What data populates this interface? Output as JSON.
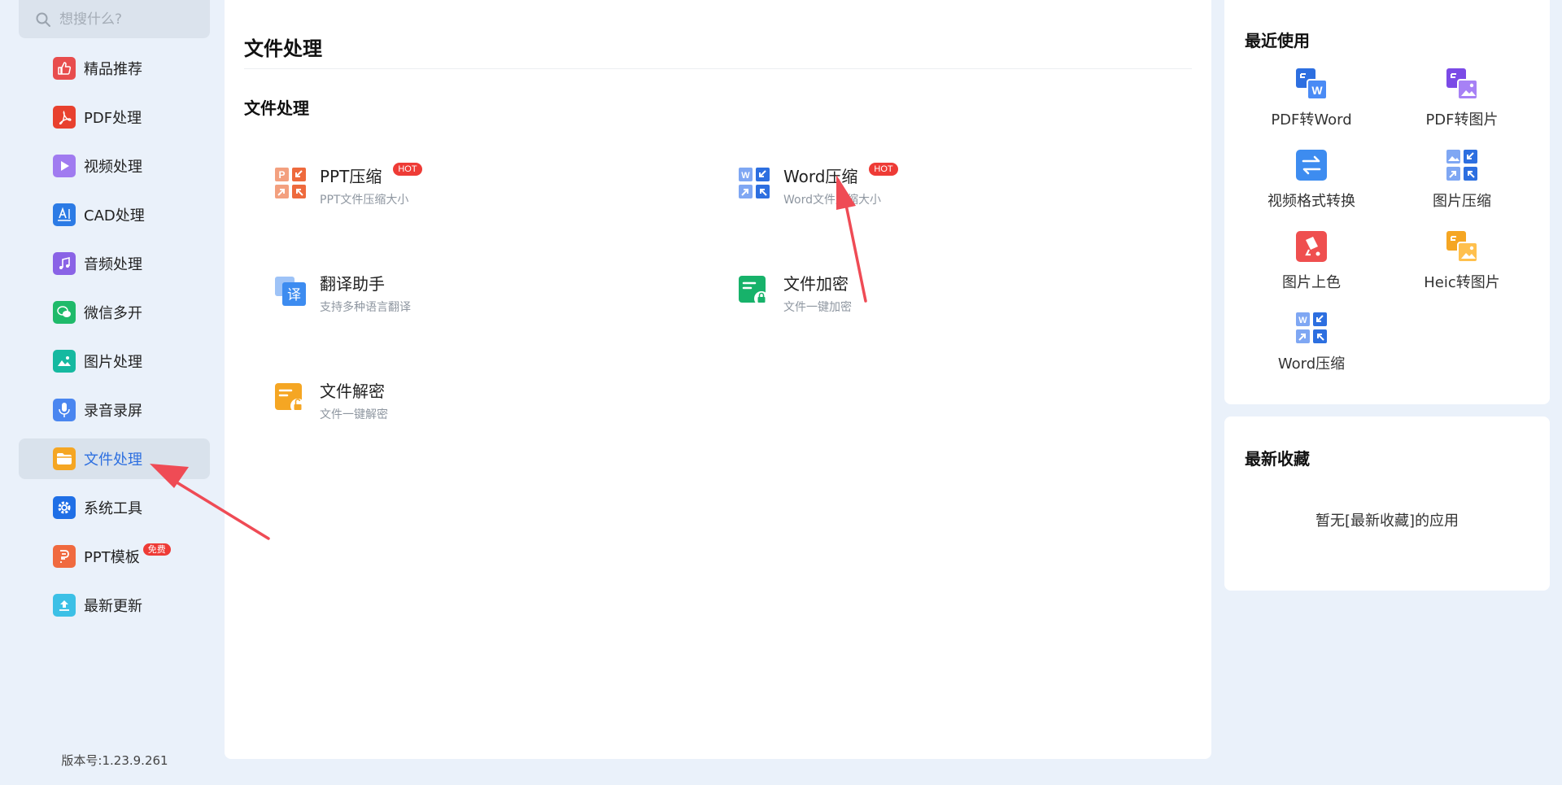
{
  "search": {
    "placeholder": "想搜什么?"
  },
  "sidebar": {
    "items": [
      {
        "label": "精品推荐",
        "icon": "thumbs-up-icon",
        "color": "#e84d4d"
      },
      {
        "label": "PDF处理",
        "icon": "pdf-icon",
        "color": "#e8412e"
      },
      {
        "label": "视频处理",
        "icon": "play-icon",
        "color": "#a07bf0"
      },
      {
        "label": "CAD处理",
        "icon": "cad-icon",
        "color": "#2c7be5"
      },
      {
        "label": "音频处理",
        "icon": "music-note-icon",
        "color": "#8a63e6"
      },
      {
        "label": "微信多开",
        "icon": "wechat-icon",
        "color": "#1fba6a"
      },
      {
        "label": "图片处理",
        "icon": "image-icon",
        "color": "#15b9a0"
      },
      {
        "label": "录音录屏",
        "icon": "microphone-icon",
        "color": "#4a86f0"
      },
      {
        "label": "文件处理",
        "icon": "folder-icon",
        "color": "#f5a623",
        "active": true
      },
      {
        "label": "系统工具",
        "icon": "gear-icon",
        "color": "#1f6fe6"
      },
      {
        "label": "PPT模板",
        "icon": "ppt-template-icon",
        "color": "#f06a3f",
        "badge": "免费"
      },
      {
        "label": "最新更新",
        "icon": "upload-icon",
        "color": "#3cc0e6"
      }
    ],
    "version": "版本号:1.23.9.261"
  },
  "main": {
    "title": "文件处理",
    "section_title": "文件处理",
    "tools": [
      {
        "name": "PPT压缩",
        "desc": "PPT文件压缩大小",
        "badge": "HOT",
        "icon": "ppt-compress-icon"
      },
      {
        "name": "Word压缩",
        "desc": "Word文件压缩大小",
        "badge": "HOT",
        "icon": "word-compress-icon"
      },
      {
        "name": "翻译助手",
        "desc": "支持多种语言翻译",
        "icon": "translate-icon"
      },
      {
        "name": "文件加密",
        "desc": "文件一键加密",
        "icon": "file-encrypt-icon"
      },
      {
        "name": "文件解密",
        "desc": "文件一键解密",
        "icon": "file-decrypt-icon"
      }
    ]
  },
  "recent": {
    "title": "最近使用",
    "apps": [
      {
        "label": "PDF转Word",
        "icon": "pdf-to-word-icon"
      },
      {
        "label": "PDF转图片",
        "icon": "pdf-to-image-icon"
      },
      {
        "label": "视频格式转换",
        "icon": "video-convert-icon"
      },
      {
        "label": "图片压缩",
        "icon": "image-compress-icon"
      },
      {
        "label": "图片上色",
        "icon": "image-colorize-icon"
      },
      {
        "label": "Heic转图片",
        "icon": "heic-to-image-icon"
      },
      {
        "label": "Word压缩",
        "icon": "word-compress-icon"
      }
    ]
  },
  "favorites": {
    "title": "最新收藏",
    "empty_text": "暂无[最新收藏]的应用"
  },
  "colors": {
    "accent": "#2d6fe0",
    "hot": "#ee3b36",
    "annotation_arrow": "#ef4b55"
  }
}
